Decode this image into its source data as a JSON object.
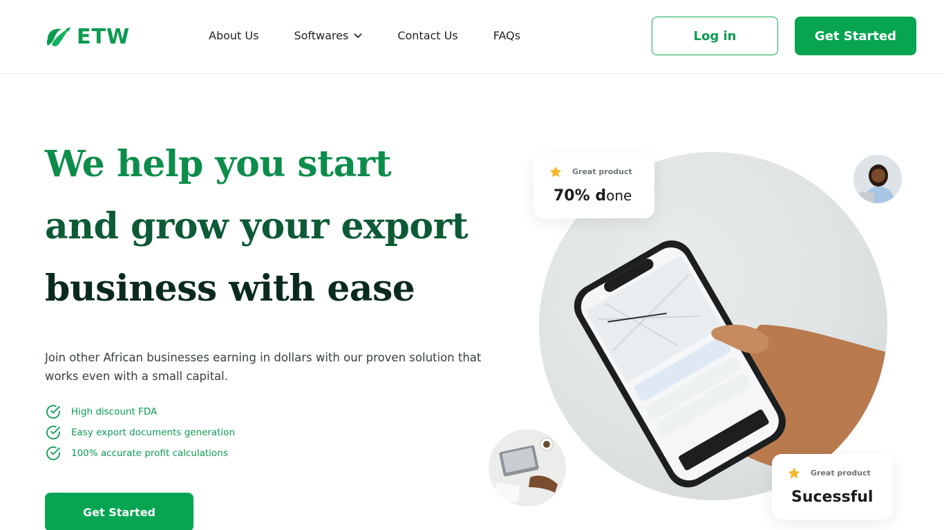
{
  "brand": {
    "name": "ETW",
    "color": "#0a9b50"
  },
  "nav": {
    "items": [
      {
        "label": "About Us"
      },
      {
        "label": "Softwares",
        "icon": "chevron-down-icon"
      },
      {
        "label": "Contact Us"
      },
      {
        "label": "FAQs"
      }
    ],
    "login_label": "Log in",
    "get_started_label": "Get Started"
  },
  "hero": {
    "headline": [
      "We help you start",
      "and grow your export",
      "business with ease"
    ],
    "description": "Join other African businesses earning in dollars with our proven solution that works even with a small capital.",
    "features": [
      "High discount FDA",
      "Easy export documents generation",
      "100% accurate profit calculations"
    ],
    "cta_label": "Get Started"
  },
  "cards": [
    {
      "label": "Great product",
      "value_bold": "70% d",
      "value_light": "one",
      "icon": "star-icon"
    },
    {
      "label": "Great product",
      "value": "Sucessful",
      "icon": "star-icon"
    }
  ],
  "colors": {
    "primary": "#07a552",
    "heading_1": "#0d8d4b",
    "heading_2": "#0c5a36",
    "heading_3": "#0b2a1e",
    "star": "#f5b82e"
  }
}
